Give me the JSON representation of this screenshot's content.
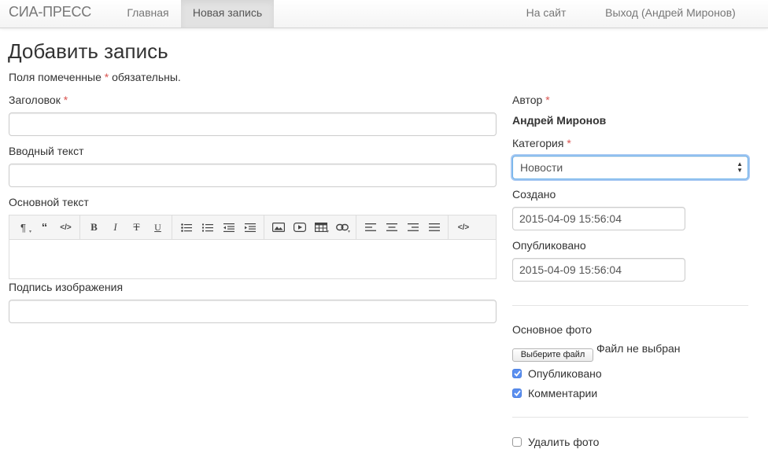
{
  "navbar": {
    "brand": "СИА-ПРЕСС",
    "links": [
      {
        "label": "Главная"
      },
      {
        "label": "Новая запись"
      }
    ],
    "right_links": [
      {
        "label": "На сайт"
      },
      {
        "label": "Выход (Андрей Миронов)"
      }
    ]
  },
  "page": {
    "title": "Добавить запись",
    "required_note_prefix": "Поля помеченные ",
    "required_star": "*",
    "required_note_suffix": " обязательны."
  },
  "form": {
    "title_label": "Заголовок",
    "title_value": "",
    "intro_label": "Вводный текст",
    "intro_value": "",
    "body_label": "Основной текст",
    "caption_label": "Подпись изображения",
    "caption_value": "",
    "toolbar_icons": [
      [
        "paragraph-icon",
        "quote-icon",
        "code-icon"
      ],
      [
        "bold-icon",
        "italic-icon",
        "strikethrough-icon",
        "underline-icon"
      ],
      [
        "unordered-list-icon",
        "ordered-list-icon",
        "outdent-icon",
        "indent-icon"
      ],
      [
        "image-icon",
        "video-icon",
        "table-icon",
        "link-icon"
      ],
      [
        "align-left-icon",
        "align-center-icon",
        "align-right-icon",
        "justify-icon"
      ],
      [
        "html-icon"
      ]
    ]
  },
  "sidebar": {
    "author_label": "Автор",
    "author_name": "Андрей Миронов",
    "category_label": "Категория",
    "category_value": "Новости",
    "created_label": "Создано",
    "created_value": "2015-04-09 15:56:04",
    "published_label": "Опубликовано",
    "published_value": "2015-04-09 15:56:04",
    "main_photo_label": "Основное фото",
    "file_button": "Выберите файл",
    "file_status": "Файл не выбран",
    "checkboxes": [
      {
        "label": "Опубликовано",
        "checked": true
      },
      {
        "label": "Комментарии",
        "checked": true
      }
    ],
    "delete_photo": {
      "label": "Удалить фото",
      "checked": false
    }
  },
  "colors": {
    "required": "#d9534f",
    "checkbox_checked": "#5b8ff0",
    "focus_ring": "#66afe9"
  }
}
